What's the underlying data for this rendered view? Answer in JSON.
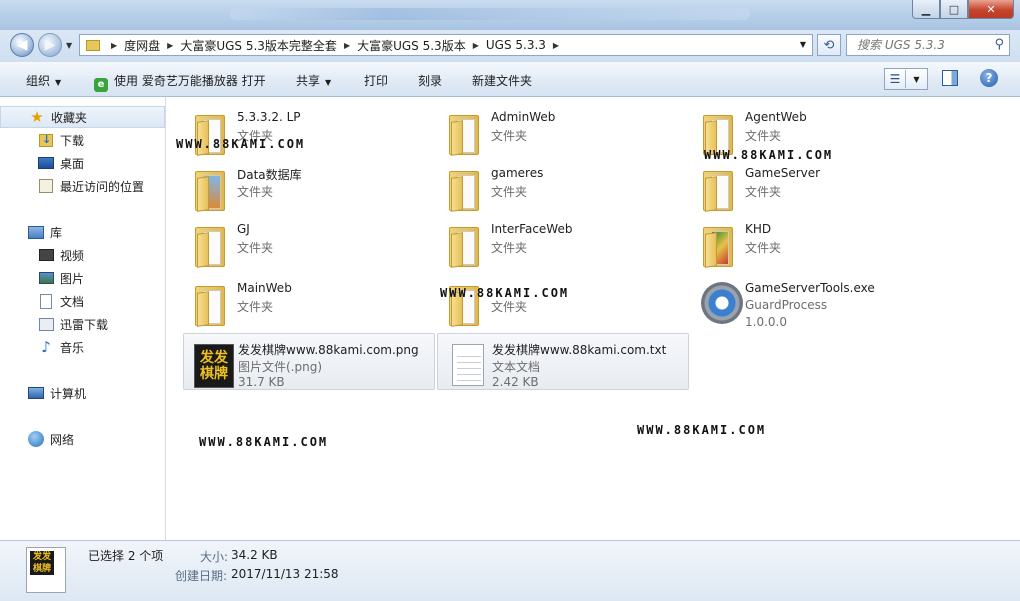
{
  "window": {
    "controls": {
      "minimize": "▁",
      "maximize": "□",
      "close": "✕"
    }
  },
  "nav": {
    "breadcrumbs": [
      "度网盘",
      "大富豪UGS 5.3版本完整全套",
      "大富豪UGS 5.3版本",
      "UGS 5.3.3"
    ],
    "search_placeholder": "搜索 UGS 5.3.3"
  },
  "toolbar": {
    "organize": "组织",
    "open_with": "使用 爱奇艺万能播放器 打开",
    "share": "共享",
    "print": "打印",
    "burn": "刻录",
    "new_folder": "新建文件夹"
  },
  "sidebar": {
    "favorites": {
      "label": "收藏夹",
      "items": [
        "下载",
        "桌面",
        "最近访问的位置"
      ]
    },
    "libraries": {
      "label": "库",
      "items": [
        "视频",
        "图片",
        "文档",
        "迅雷下载",
        "音乐"
      ]
    },
    "computer": "计算机",
    "network": "网络"
  },
  "files": [
    {
      "name": "5.3.3.2. LP",
      "type": "文件夹",
      "kind": "folder"
    },
    {
      "name": "AdminWeb",
      "type": "文件夹",
      "kind": "folder"
    },
    {
      "name": "AgentWeb",
      "type": "文件夹",
      "kind": "folder"
    },
    {
      "name": "Data数据库",
      "type": "文件夹",
      "kind": "folder"
    },
    {
      "name": "gameres",
      "type": "文件夹",
      "kind": "folder"
    },
    {
      "name": "GameServer",
      "type": "文件夹",
      "kind": "folder"
    },
    {
      "name": "GJ",
      "type": "文件夹",
      "kind": "folder"
    },
    {
      "name": "InterFaceWeb",
      "type": "文件夹",
      "kind": "folder"
    },
    {
      "name": "KHD",
      "type": "文件夹",
      "kind": "folder"
    },
    {
      "name": "MainWeb",
      "type": "文件夹",
      "kind": "folder"
    },
    {
      "name": "",
      "type": "文件夹",
      "kind": "folder"
    },
    {
      "name": "GameServerTools.exe",
      "type": "GuardProcess",
      "extra": "1.0.0.0",
      "kind": "exe"
    },
    {
      "name": "发发棋牌www.88kami.com.png",
      "type": "图片文件(.png)",
      "extra": "31.7 KB",
      "kind": "png",
      "selected": true
    },
    {
      "name": "发发棋牌www.88kami.com.txt",
      "type": "文本文档",
      "extra": "2.42 KB",
      "kind": "txt",
      "selected": true
    }
  ],
  "png_icon_text": [
    "发发",
    "棋牌"
  ],
  "watermarks": [
    "WWW.88KAMI.COM",
    "WWW.88KAMI.COM",
    "WWW.88KAMI.COM",
    "WWW.88KAMI.COM",
    "WWW.88KAMI.COM"
  ],
  "status": {
    "selected": "已选择 2 个项",
    "size_label": "大小:",
    "size_value": "34.2 KB",
    "date_label": "创建日期:",
    "date_value": "2017/11/13 21:58"
  },
  "colors": {
    "accent": "#2f5c94",
    "folder": "#e7c15a",
    "title_bar": "#b7cfe9"
  }
}
